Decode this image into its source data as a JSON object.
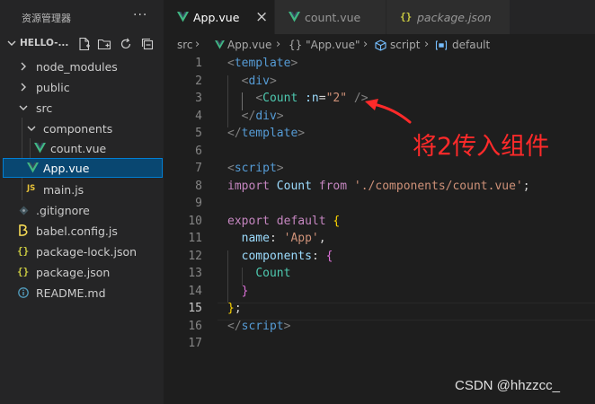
{
  "explorer": {
    "title": "资源管理器",
    "more": "···",
    "project": "HELLO-...",
    "tree": [
      {
        "label": "node_modules",
        "icon": "chevron-right-icon"
      },
      {
        "label": "public",
        "icon": "chevron-right-icon"
      },
      {
        "label": "src",
        "icon": "chevron-down-icon"
      },
      {
        "label": "components",
        "icon": "chevron-down-icon"
      },
      {
        "label": "count.vue",
        "icon": "vue-icon"
      },
      {
        "label": "App.vue",
        "icon": "vue-icon"
      },
      {
        "label": "main.js",
        "icon": "js-icon",
        "icon_text": "JS"
      },
      {
        "label": ".gitignore",
        "icon": "gitignore-icon"
      },
      {
        "label": "babel.config.js",
        "icon": "babel-icon"
      },
      {
        "label": "package-lock.json",
        "icon": "json-icon",
        "icon_text": "{}"
      },
      {
        "label": "package.json",
        "icon": "json-icon",
        "icon_text": "{}"
      },
      {
        "label": "README.md",
        "icon": "info-icon"
      }
    ]
  },
  "tabs": [
    {
      "label": "App.vue",
      "close": "×"
    },
    {
      "label": "count.vue"
    },
    {
      "label": "package.json",
      "icon_text": "{}"
    }
  ],
  "breadcrumb": [
    "src",
    "App.vue",
    "{} \"App.vue\"",
    "script",
    "default"
  ],
  "code": {
    "current_line": 15,
    "lines": [
      {
        "n": "1"
      },
      {
        "n": "2"
      },
      {
        "n": "3"
      },
      {
        "n": "4"
      },
      {
        "n": "5"
      },
      {
        "n": "6"
      },
      {
        "n": "7"
      },
      {
        "n": "8"
      },
      {
        "n": "9"
      },
      {
        "n": "10"
      },
      {
        "n": "11"
      },
      {
        "n": "12"
      },
      {
        "n": "13"
      },
      {
        "n": "14"
      },
      {
        "n": "15"
      },
      {
        "n": "16"
      },
      {
        "n": "17"
      }
    ],
    "tokens": {
      "template": "template",
      "div": "div",
      "count_comp": "Count",
      "attr_n": ":n",
      "attr_val": "\"2\"",
      "script": "script",
      "import": "import",
      "from": "from",
      "path": "'./components/count.vue'",
      "export": "export",
      "default": "default",
      "name": "name",
      "app": "'App'",
      "components": "components"
    }
  },
  "annotation": "将2传入组件",
  "watermark": "CSDN @hhzzcc_",
  "colors": {
    "annotation": "#ff2a2a",
    "selection": "#094771",
    "vue_green": "#41b883"
  }
}
